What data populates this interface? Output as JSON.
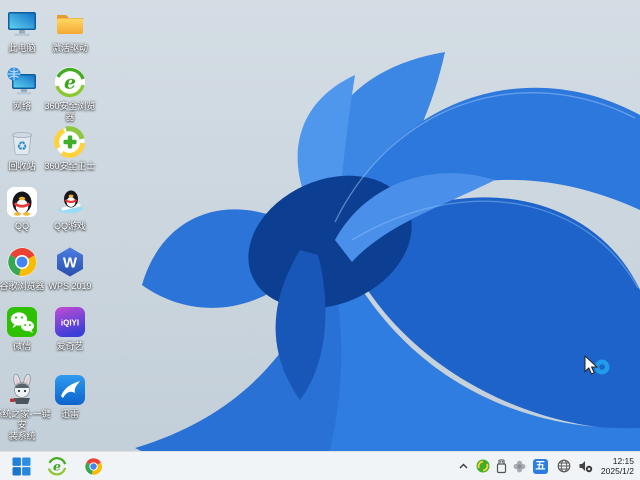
{
  "desktop": {
    "icons": [
      {
        "name": "this-pc",
        "label": "此电脑"
      },
      {
        "name": "activation-driver-folder",
        "label": "激活驱动"
      },
      {
        "name": "network",
        "label": "网络"
      },
      {
        "name": "360-secure-browser",
        "label": "360安全浏览\n器"
      },
      {
        "name": "recycle-bin",
        "label": "回收站"
      },
      {
        "name": "360-safeguard",
        "label": "360安全卫士"
      },
      {
        "name": "qq",
        "label": "QQ"
      },
      {
        "name": "qq-games",
        "label": "QQ游戏"
      },
      {
        "name": "chrome",
        "label": "谷歌浏览器"
      },
      {
        "name": "wps-2019",
        "label": "WPS 2019"
      },
      {
        "name": "wechat",
        "label": "微信"
      },
      {
        "name": "iqiyi",
        "label": "爱奇艺",
        "logo_text": "iQIYI"
      },
      {
        "name": "system-home-installer",
        "label": "系统之家-一键安\n装系统"
      },
      {
        "name": "xunlei",
        "label": "迅雷"
      }
    ]
  },
  "taskbar": {
    "pinned": [
      "start",
      "360-secure-browser",
      "chrome"
    ],
    "tray": {
      "input_indicator": "五",
      "time": "12:15",
      "date": "2025/1/2"
    }
  },
  "colors": {
    "desktop_bg": "#c9d4dd",
    "bloom_blue": "#2f7de1",
    "bloom_dark": "#0c3f92",
    "taskbar_bg": "#f1f4f7",
    "accent": "#2b7de0"
  },
  "wps_letter": "W",
  "recycle_glyph": "♻"
}
